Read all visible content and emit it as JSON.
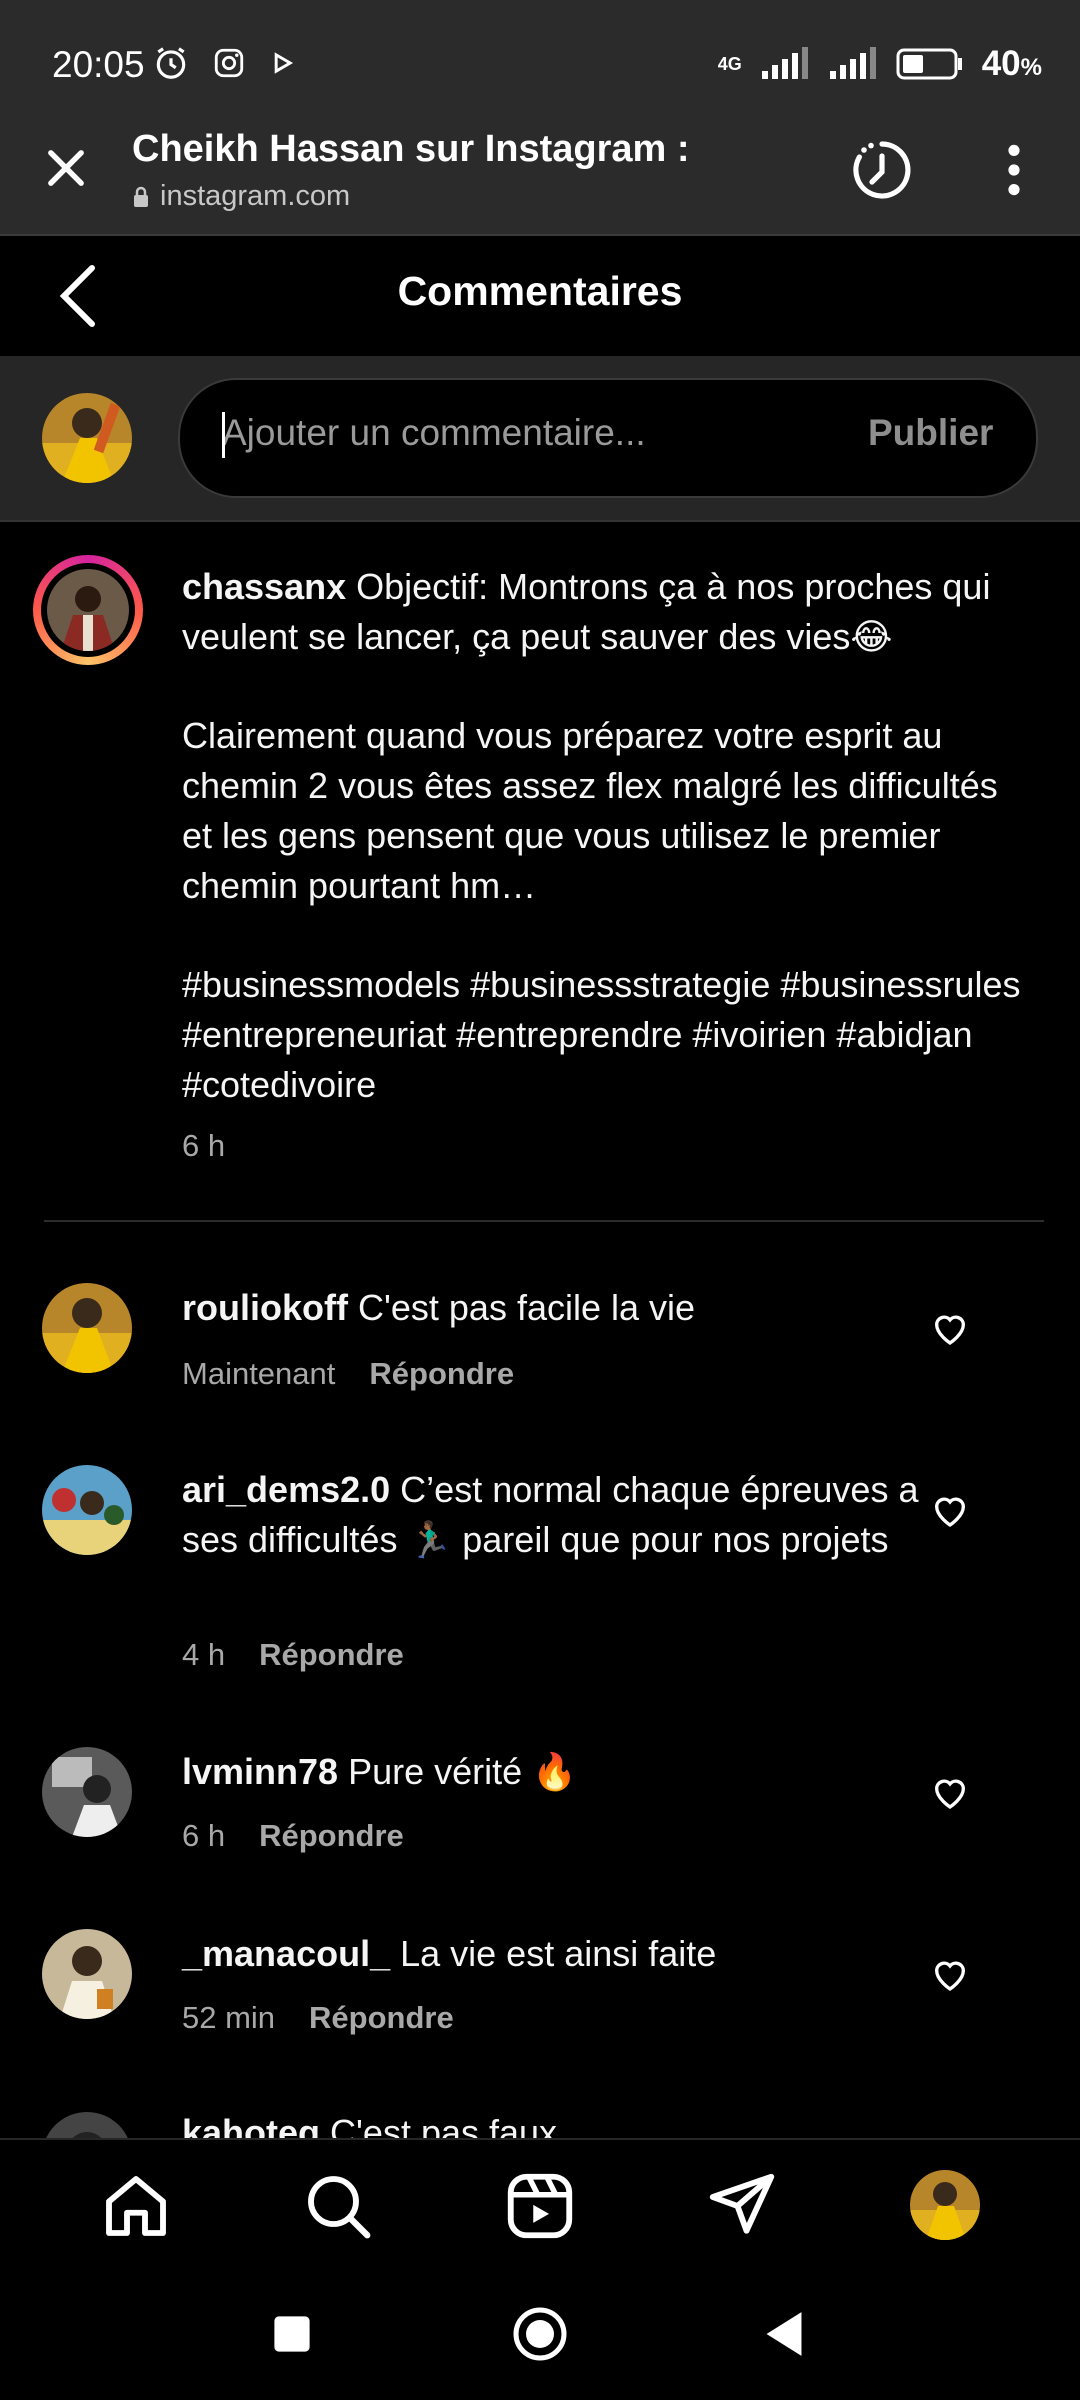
{
  "status_bar": {
    "time": "20:05",
    "network": "4G",
    "battery": "40",
    "battery_unit": "%"
  },
  "browser": {
    "title": "Cheikh Hassan sur Instagram :",
    "url": "instagram.com"
  },
  "header": {
    "title": "Commentaires"
  },
  "composer": {
    "placeholder": "Ajouter un commentaire...",
    "publish_label": "Publier"
  },
  "caption": {
    "username": "chassanx",
    "text_p1": "Objectif: Montrons ça à nos proches qui veulent se lancer, ça peut sauver des vies😂",
    "text_p2": "Clairement quand vous préparez votre esprit au chemin 2 vous êtes assez flex malgré les difficultés et les gens pensent que vous utilisez le premier chemin pourtant hm…",
    "text_p3": "#businessmodels #businessstrategie #businessrules #entrepreneuriat #entreprendre #ivoirien #abidjan #cotedivoire",
    "time": "6 h"
  },
  "comments": [
    {
      "username": "rouliokoff",
      "text": "C'est pas facile la vie",
      "time": "Maintenant",
      "reply": "Répondre"
    },
    {
      "username": "ari_dems2.0",
      "text": "C’est normal chaque épreuves a ses difficultés 🏃🏾‍♂️ pareil que pour nos projets",
      "time": "4 h",
      "reply": "Répondre"
    },
    {
      "username": "lvminn78",
      "text": "Pure vérité 🔥",
      "time": "6 h",
      "reply": "Répondre"
    },
    {
      "username": "_manacoul_",
      "text": "La vie est ainsi faite",
      "time": "52 min",
      "reply": "Répondre"
    },
    {
      "username": "kahoteg",
      "text": "C'est pas faux"
    }
  ],
  "colors": {
    "background": "#000000",
    "bar": "#2b2b2b",
    "secondary_text": "#a8a8a8"
  },
  "icons": {
    "nav": [
      "home-icon",
      "search-icon",
      "reels-icon",
      "direct-icon",
      "profile-avatar"
    ]
  }
}
